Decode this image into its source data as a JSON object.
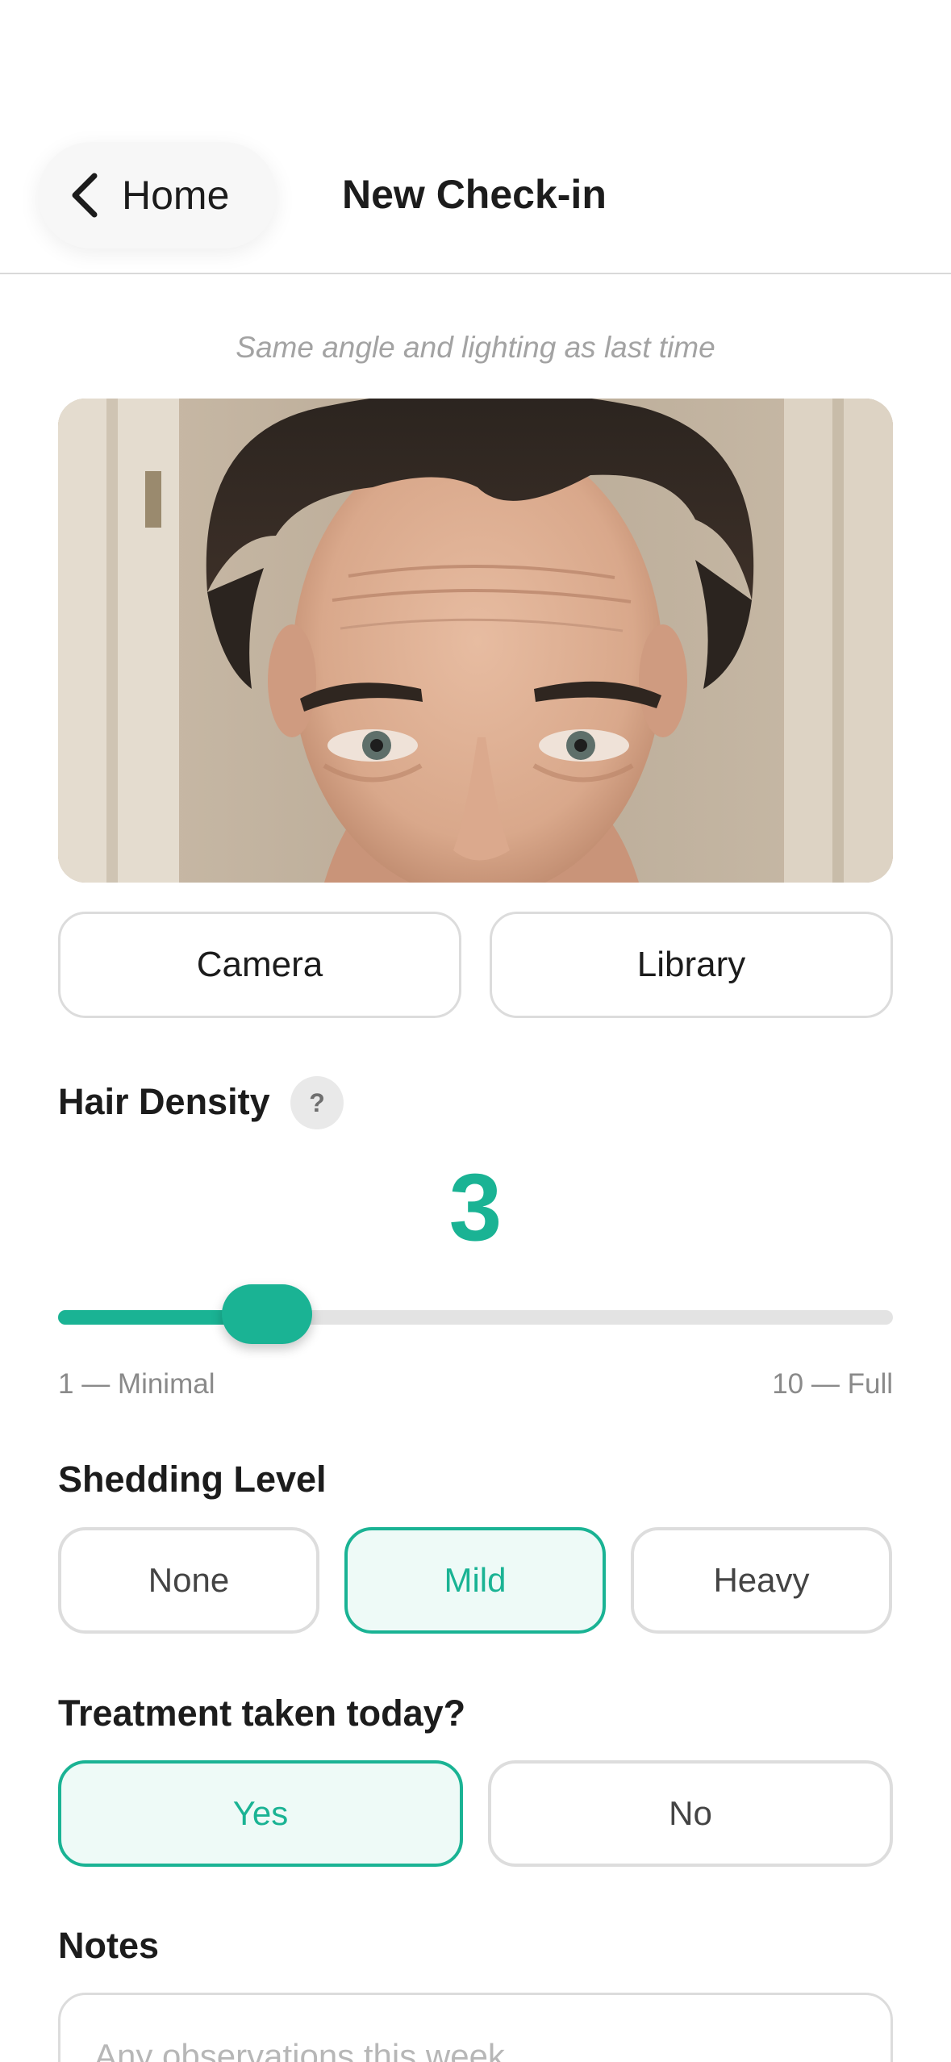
{
  "header": {
    "back_label": "Home",
    "title": "New Check-in"
  },
  "photo_hint": "Same angle and lighting as last time",
  "photo_actions": {
    "camera_label": "Camera",
    "library_label": "Library"
  },
  "hair_density": {
    "label": "Hair Density",
    "help_symbol": "?",
    "value": 3,
    "value_text": "3",
    "min_label": "1 — Minimal",
    "max_label": "10 — Full",
    "fill_fraction": 0.25
  },
  "shedding": {
    "label": "Shedding Level",
    "options": [
      "None",
      "Mild",
      "Heavy"
    ],
    "selected": "Mild"
  },
  "treatment": {
    "label": "Treatment taken today?",
    "options": [
      "Yes",
      "No"
    ],
    "selected": "Yes"
  },
  "notes": {
    "label": "Notes",
    "placeholder": "Any observations this week..."
  },
  "colors": {
    "accent": "#1ab394",
    "accent_tint": "#eefaf7",
    "border": "#dddddd"
  }
}
